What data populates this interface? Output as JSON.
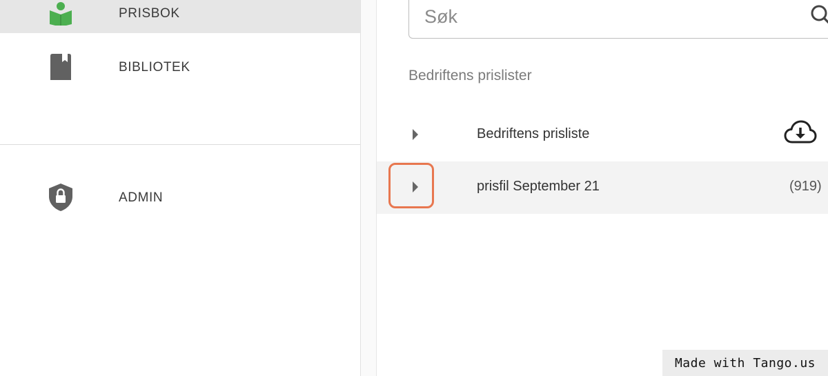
{
  "sidebar": {
    "items": [
      {
        "label": "PRISBOK",
        "icon": "book-reader-icon",
        "active": true,
        "icon_color": "#4caf50"
      },
      {
        "label": "BIBLIOTEK",
        "icon": "bookmark-icon",
        "active": false,
        "icon_color": "#616161"
      },
      {
        "label": "ADMIN",
        "icon": "shield-lock-icon",
        "active": false,
        "icon_color": "#616161"
      }
    ]
  },
  "search": {
    "placeholder": "Søk",
    "value": ""
  },
  "main": {
    "section_title": "Bedriftens prislister",
    "rows": [
      {
        "label": "Bedriftens prisliste",
        "action_icon": "cloud-download-icon"
      },
      {
        "label": "prisfil September 21",
        "count": "(919)"
      }
    ]
  },
  "colors": {
    "accent_focus": "#e8774f",
    "brand_green": "#4caf50"
  },
  "watermark": {
    "text": "Made with Tango.us"
  }
}
